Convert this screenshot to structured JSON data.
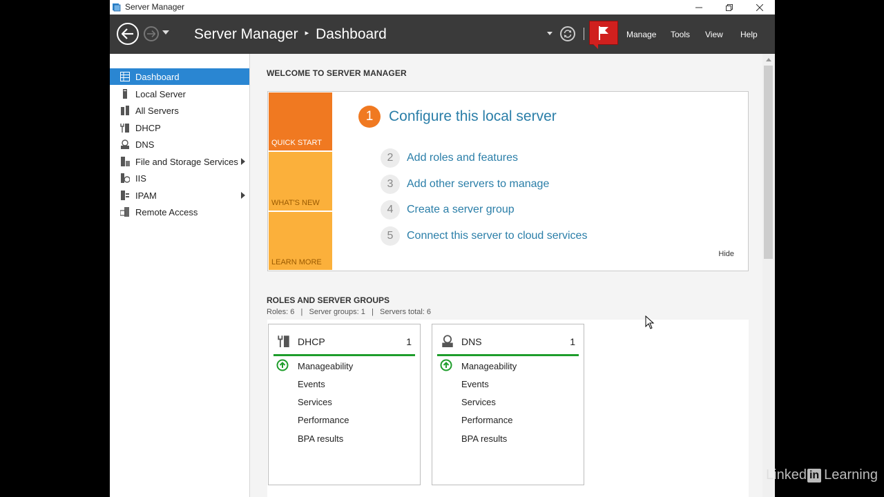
{
  "window": {
    "title": "Server Manager"
  },
  "header": {
    "app_name": "Server Manager",
    "separator": "▸",
    "page": "Dashboard",
    "menu": [
      "Manage",
      "Tools",
      "View",
      "Help"
    ]
  },
  "sidebar": {
    "items": [
      {
        "label": "Dashboard",
        "icon": "dashboard-icon",
        "active": true
      },
      {
        "label": "Local Server",
        "icon": "server-icon"
      },
      {
        "label": "All Servers",
        "icon": "servers-icon"
      },
      {
        "label": "DHCP",
        "icon": "dhcp-icon"
      },
      {
        "label": "DNS",
        "icon": "dns-icon"
      },
      {
        "label": "File and Storage Services",
        "icon": "storage-icon",
        "expandable": true
      },
      {
        "label": "IIS",
        "icon": "iis-icon"
      },
      {
        "label": "IPAM",
        "icon": "ipam-icon",
        "expandable": true
      },
      {
        "label": "Remote Access",
        "icon": "remote-access-icon"
      }
    ]
  },
  "welcome": {
    "title": "WELCOME TO SERVER MANAGER",
    "tiles": [
      "QUICK START",
      "WHAT'S NEW",
      "LEARN MORE"
    ],
    "main_step": {
      "num": "1",
      "text": "Configure this local server"
    },
    "steps": [
      {
        "num": "2",
        "text": "Add roles and features"
      },
      {
        "num": "3",
        "text": "Add other servers to manage"
      },
      {
        "num": "4",
        "text": "Create a server group"
      },
      {
        "num": "5",
        "text": "Connect this server to cloud services"
      }
    ],
    "hide": "Hide"
  },
  "roles": {
    "title": "ROLES AND SERVER GROUPS",
    "summary": "Roles: 6   |   Server groups: 1   |   Servers total: 6",
    "cards": [
      {
        "name": "DHCP",
        "count": "1",
        "rows": [
          "Manageability",
          "Events",
          "Services",
          "Performance",
          "BPA results"
        ]
      },
      {
        "name": "DNS",
        "count": "1",
        "rows": [
          "Manageability",
          "Events",
          "Services",
          "Performance",
          "BPA results"
        ]
      }
    ]
  },
  "watermark": {
    "pre": "Linked",
    "in": "in",
    "post": "Learning"
  },
  "colors": {
    "accent_blue": "#2a86d2",
    "orange": "#f07921",
    "amber": "#fbb03b",
    "status_green": "#1e9d2b",
    "flag_red": "#d0201e"
  }
}
